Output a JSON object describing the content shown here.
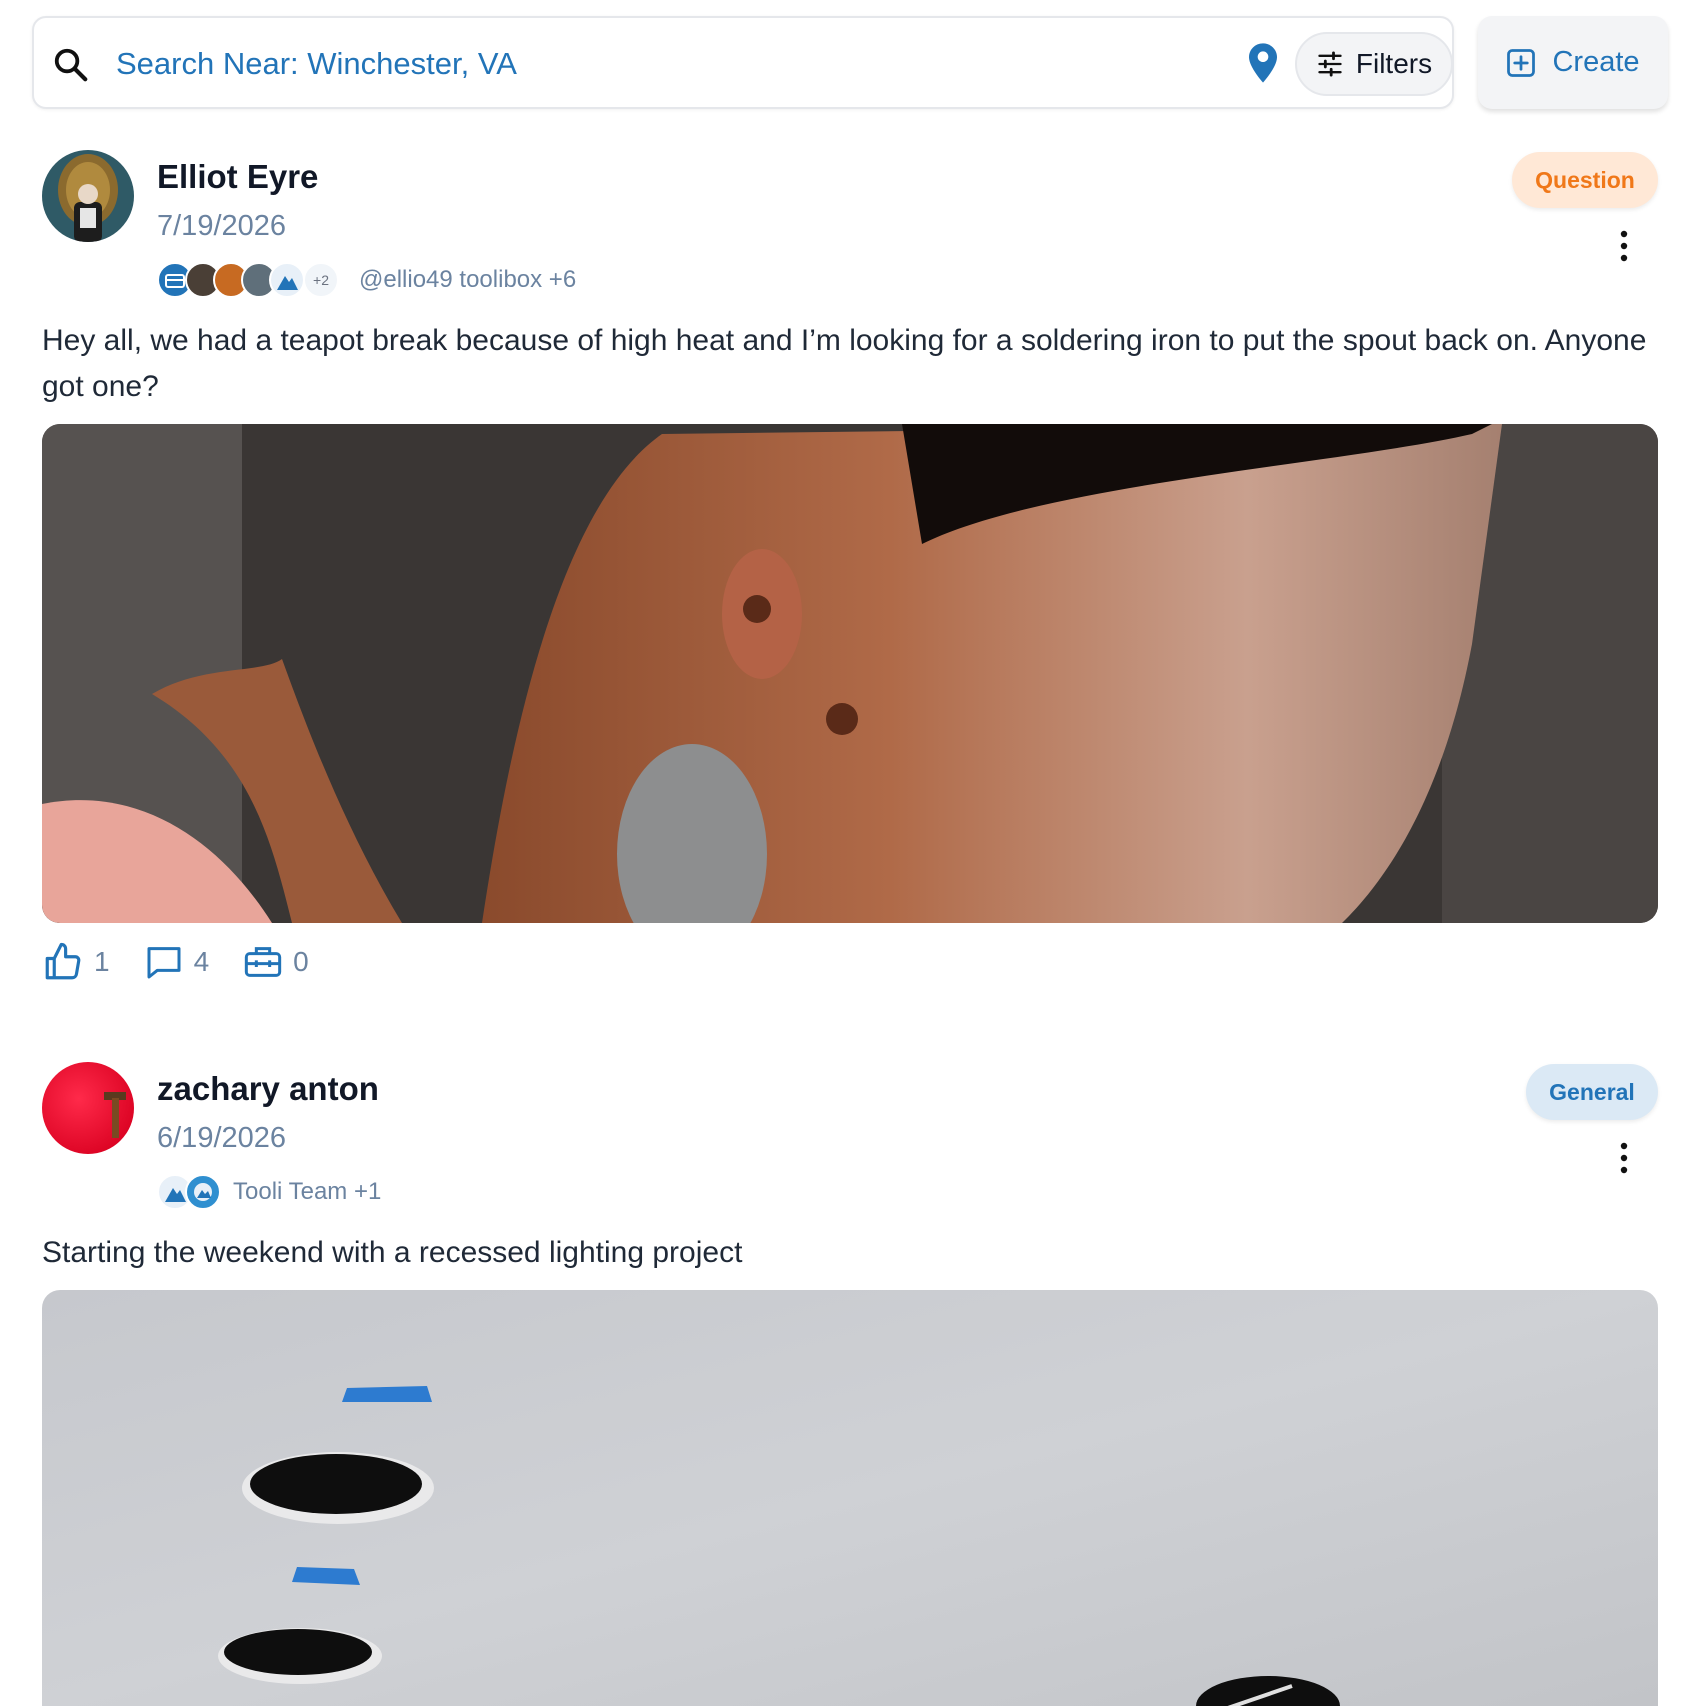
{
  "search": {
    "placeholder": "Search Near: Winchester, VA",
    "filters_label": "Filters",
    "create_label": "Create"
  },
  "colors": {
    "accent": "#2274b8",
    "muted": "#6b83a0",
    "question_bg": "#ffe8d6",
    "question_text": "#f07819",
    "general_bg": "#dbe9f5",
    "general_text": "#2274b8"
  },
  "posts": [
    {
      "author": "Elliot Eyre",
      "date": "7/19/2026",
      "badge": "Question",
      "groups_more": "+2",
      "groups_text": "@ellio49 toolibox +6",
      "body": "Hey all, we had a teapot break because of high heat and I’m looking for a soldering iron to put the spout back on. Anyone got one?",
      "likes": "1",
      "comments": "4",
      "tools": "0"
    },
    {
      "author": "zachary anton",
      "date": "6/19/2026",
      "badge": "General",
      "groups_text": "Tooli Team +1",
      "body": "Starting the weekend with a recessed lighting project"
    }
  ]
}
